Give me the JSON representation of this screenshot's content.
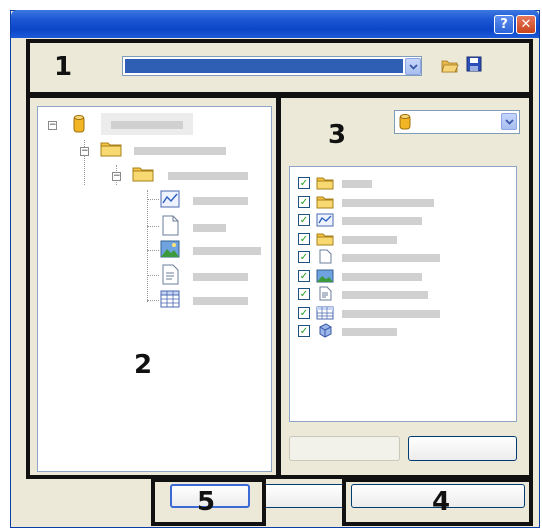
{
  "titlebar": {
    "help_glyph": "?",
    "close_glyph": "✕"
  },
  "callouts": {
    "area_1": "1",
    "area_2": "2",
    "area_3": "3",
    "area_4": "4",
    "area_5": "5"
  },
  "toolbar": {
    "selected_value": "",
    "icons": [
      "open-folder-icon",
      "save-disk-icon"
    ]
  },
  "tree": {
    "nodes": [
      {
        "icon": "database-icon",
        "label": "",
        "level": 0
      },
      {
        "icon": "folder-icon",
        "label": "",
        "level": 1
      },
      {
        "icon": "folder-icon",
        "label": "",
        "level": 2
      },
      {
        "icon": "chart-item-icon",
        "label": "",
        "level": 3
      },
      {
        "icon": "document-icon",
        "label": "",
        "level": 3
      },
      {
        "icon": "image-icon",
        "label": "",
        "level": 3
      },
      {
        "icon": "report-icon",
        "label": "",
        "level": 3
      },
      {
        "icon": "table-icon",
        "label": "",
        "level": 3
      }
    ]
  },
  "filter": {
    "selected_value": ""
  },
  "filter_list": {
    "items": [
      {
        "icon": "folder-icon",
        "checked": true
      },
      {
        "icon": "folder-icon",
        "checked": true
      },
      {
        "icon": "chart-item-icon",
        "checked": true
      },
      {
        "icon": "folder-icon",
        "checked": true
      },
      {
        "icon": "document-icon",
        "checked": true
      },
      {
        "icon": "image-icon",
        "checked": true
      },
      {
        "icon": "report-icon",
        "checked": true
      },
      {
        "icon": "table-icon",
        "checked": true
      },
      {
        "icon": "cube-icon",
        "checked": true
      }
    ]
  },
  "colors": {
    "titlebar": "#0a46c7",
    "dialog_bg": "#ece9d8",
    "combo_selection": "#2f5fb5",
    "callout_border": "#111111",
    "checkmark": "#21a121"
  }
}
